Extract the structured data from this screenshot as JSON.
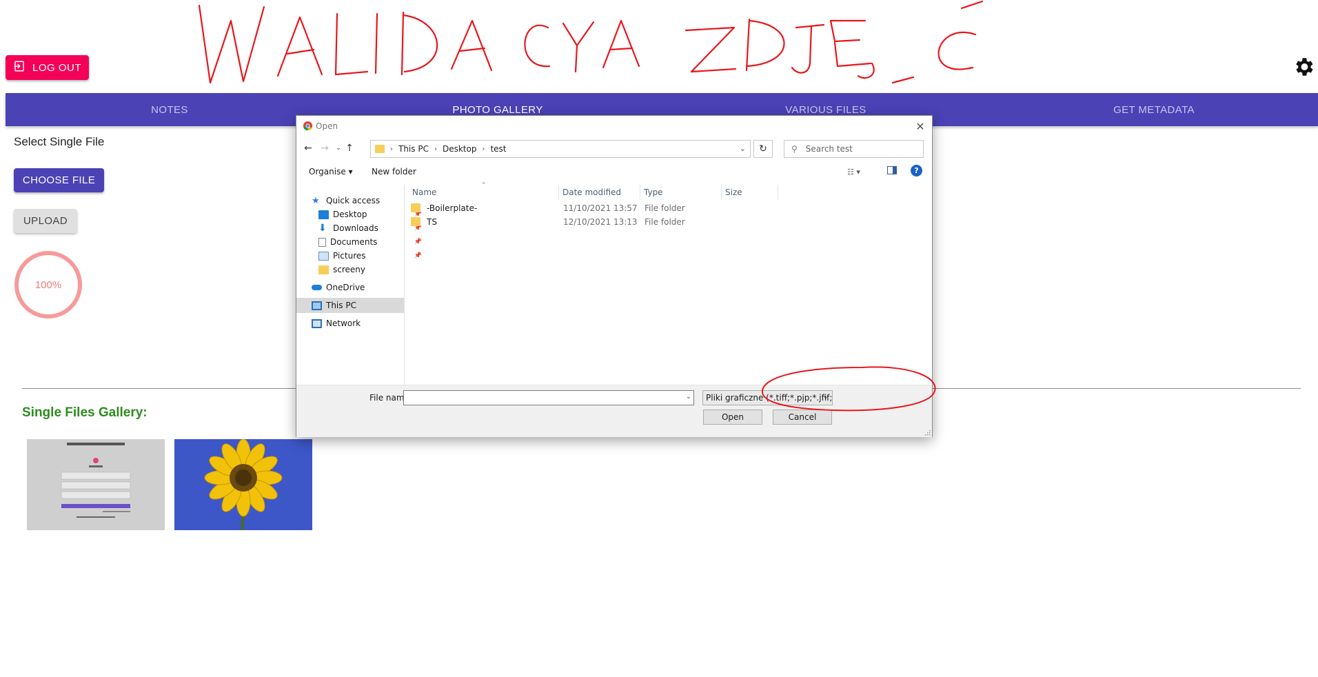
{
  "header": {
    "logout_label": "LOG OUT",
    "handwritten_title": "WALIDACJA ZDJĘĆ",
    "accent_color": "#f50057"
  },
  "nav": {
    "tabs": [
      {
        "label": "NOTES",
        "active": false
      },
      {
        "label": "PHOTO GALLERY",
        "active": true
      },
      {
        "label": "VARIOUS FILES",
        "active": false
      },
      {
        "label": "GET METADATA",
        "active": false
      }
    ],
    "bar_color": "#4a42b5"
  },
  "main": {
    "select_label": "Select Single File",
    "choose_label": "CHOOSE FILE",
    "upload_label": "UPLOAD",
    "progress_text": "100%",
    "progress_value": 100,
    "gallery_title": "Single Files Gallery:"
  },
  "dialog": {
    "title": "Open",
    "breadcrumb": [
      "This PC",
      "Desktop",
      "test"
    ],
    "search_placeholder": "Search test",
    "organise_label": "Organise",
    "new_folder_label": "New folder",
    "nav_items": [
      {
        "label": "Quick access",
        "icon": "star-icon",
        "pinned": false
      },
      {
        "label": "Desktop",
        "icon": "desktop-icon",
        "pinned": true
      },
      {
        "label": "Downloads",
        "icon": "download-icon",
        "pinned": true
      },
      {
        "label": "Documents",
        "icon": "document-icon",
        "pinned": true
      },
      {
        "label": "Pictures",
        "icon": "pictures-icon",
        "pinned": true
      },
      {
        "label": "screeny",
        "icon": "folder-icon",
        "pinned": false
      },
      {
        "label": "OneDrive",
        "icon": "cloud-icon",
        "pinned": false
      },
      {
        "label": "This PC",
        "icon": "computer-icon",
        "pinned": false,
        "selected": true
      },
      {
        "label": "Network",
        "icon": "network-icon",
        "pinned": false
      }
    ],
    "columns": [
      "Name",
      "Date modified",
      "Type",
      "Size"
    ],
    "files": [
      {
        "name": "-Boilerplate-",
        "modified": "11/10/2021 13:57",
        "type": "File folder",
        "size": ""
      },
      {
        "name": "TS",
        "modified": "12/10/2021 13:13",
        "type": "File folder",
        "size": ""
      }
    ],
    "file_name_label": "File name:",
    "file_name_value": "",
    "file_type_value": "Pliki graficzne (*.tiff;*.pjp;*.jfif;*",
    "open_label": "Open",
    "cancel_label": "Cancel"
  }
}
